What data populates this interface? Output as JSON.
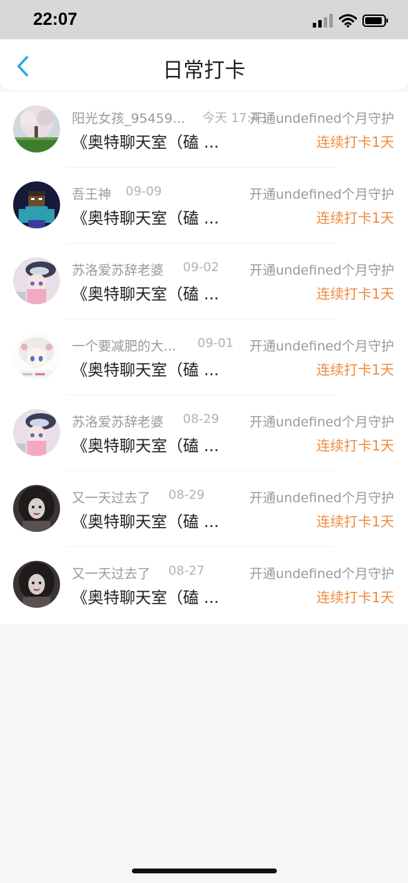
{
  "status_bar": {
    "time": "22:07"
  },
  "header": {
    "title": "日常打卡"
  },
  "rows": [
    {
      "name": "阳光女孩_95459...",
      "date": "今天 17:43",
      "guard": "开通undefined个月守护",
      "room": "《奥特聊天室（磕 ...",
      "streak": "连续打卡1天",
      "avatar": "tree-photo"
    },
    {
      "name": "吾王神",
      "date": "09-09",
      "guard": "开通undefined个月守护",
      "room": "《奥特聊天室（磕 ...",
      "streak": "连续打卡1天",
      "avatar": "pixel-character"
    },
    {
      "name": "苏洛爱苏辞老婆",
      "date": "09-02",
      "guard": "开通undefined个月守护",
      "room": "《奥特聊天室（磕 ...",
      "streak": "连续打卡1天",
      "avatar": "anime-girl-pink"
    },
    {
      "name": "一个要减肥的大...",
      "date": "09-01",
      "guard": "开通undefined个月守护",
      "room": "《奥特聊天室（磕 ...",
      "streak": "连续打卡1天",
      "avatar": "anime-girl-white"
    },
    {
      "name": "苏洛爱苏辞老婆",
      "date": "08-29",
      "guard": "开通undefined个月守护",
      "room": "《奥特聊天室（磕 ...",
      "streak": "连续打卡1天",
      "avatar": "anime-girl-pink"
    },
    {
      "name": "又一天过去了",
      "date": "08-29",
      "guard": "开通undefined个月守护",
      "room": "《奥特聊天室（磕 ...",
      "streak": "连续打卡1天",
      "avatar": "dark-portrait"
    },
    {
      "name": "又一天过去了",
      "date": "08-27",
      "guard": "开通undefined个月守护",
      "room": "《奥特聊天室（磕 ...",
      "streak": "连续打卡1天",
      "avatar": "dark-portrait"
    }
  ],
  "colors": {
    "accent": "#2aa7e0",
    "streak": "#f08b3d",
    "secondary_text": "#9a9a9a"
  }
}
